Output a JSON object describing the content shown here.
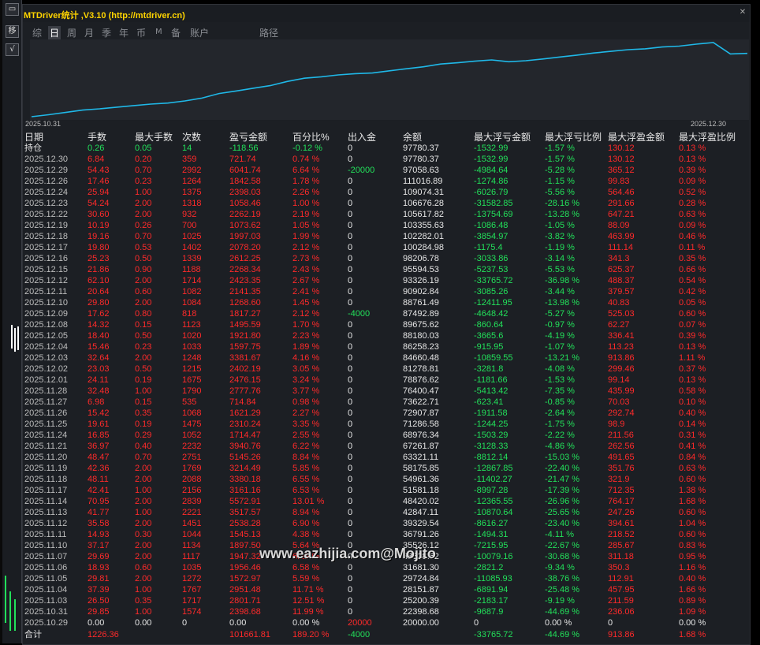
{
  "title": "MTDriver统计 ,V3.10 (http://mtdriver.cn)",
  "left_buttons": [
    "移",
    "√"
  ],
  "tabs": [
    {
      "label": "综",
      "active": false
    },
    {
      "label": "日",
      "active": true
    },
    {
      "label": "周",
      "active": false
    },
    {
      "label": "月",
      "active": false
    },
    {
      "label": "季",
      "active": false
    },
    {
      "label": "年",
      "active": false
    },
    {
      "label": "币",
      "active": false
    },
    {
      "label": "M",
      "active": false
    },
    {
      "label": "备",
      "active": false
    },
    {
      "label": "账户",
      "active": false
    },
    {
      "label": "路径",
      "active": false
    }
  ],
  "chart": {
    "start_label": "2025.10.31",
    "end_label": "2025.12.30",
    "line_color": "#1fb8e8",
    "balance_series": [
      20000,
      22398.68,
      25200.39,
      28151.87,
      29724.84,
      31681.3,
      33628.62,
      35526.12,
      36791.26,
      39329.54,
      42847.11,
      48420.02,
      51581.18,
      54961.36,
      58175.85,
      63321.11,
      67261.87,
      68976.34,
      71286.58,
      72907.87,
      73622.71,
      76400.47,
      78876.62,
      81278.81,
      84660.48,
      86258.23,
      88180.03,
      89675.62,
      87492.89,
      88761.49,
      90902.84,
      93326.19,
      95594.53,
      98206.78,
      100284.98,
      102282.01,
      103355.63,
      105617.82,
      106676.28,
      109074.31,
      111016.89,
      97058.63,
      97780.37
    ]
  },
  "colors": {
    "red": "#ff2a2a",
    "green": "#22e05a",
    "white": "#e6e6e6",
    "gray": "#bdbdbd"
  },
  "columns": [
    "日期",
    "手数",
    "最大手数",
    "次数",
    "盈亏金额",
    "百分比%",
    "出入金",
    "余额",
    "最大浮亏金额",
    "最大浮亏比例",
    "最大浮盈金额",
    "最大浮盈比例"
  ],
  "position_row": {
    "label": "持仓",
    "cells": [
      "0.26",
      "0.05",
      "14",
      "-118.56",
      "-0.12 %",
      "0",
      "97780.37",
      "-1532.99",
      "-1.57 %",
      "130.12",
      "0.13 %"
    ]
  },
  "rows": [
    [
      "2025.12.30",
      "6.84",
      "0.20",
      "359",
      "721.74",
      "0.74 %",
      "0",
      "97780.37",
      "-1532.99",
      "-1.57 %",
      "130.12",
      "0.13 %"
    ],
    [
      "2025.12.29",
      "54.43",
      "0.70",
      "2992",
      "6041.74",
      "6.64 %",
      "-20000",
      "97058.63",
      "-4984.64",
      "-5.28 %",
      "365.12",
      "0.39 %"
    ],
    [
      "2025.12.26",
      "17.46",
      "0.23",
      "1264",
      "1842.58",
      "1.78 %",
      "0",
      "111016.89",
      "-1274.86",
      "-1.15 %",
      "99.83",
      "0.09 %"
    ],
    [
      "2025.12.24",
      "25.94",
      "1.00",
      "1375",
      "2398.03",
      "2.26 %",
      "0",
      "109074.31",
      "-6026.79",
      "-5.56 %",
      "564.46",
      "0.52 %"
    ],
    [
      "2025.12.23",
      "54.24",
      "2.00",
      "1318",
      "1058.46",
      "1.00 %",
      "0",
      "106676.28",
      "-31582.85",
      "-28.16 %",
      "291.66",
      "0.28 %"
    ],
    [
      "2025.12.22",
      "30.60",
      "2.00",
      "932",
      "2262.19",
      "2.19 %",
      "0",
      "105617.82",
      "-13754.69",
      "-13.28 %",
      "647.21",
      "0.63 %"
    ],
    [
      "2025.12.19",
      "10.19",
      "0.26",
      "700",
      "1073.62",
      "1.05 %",
      "0",
      "103355.63",
      "-1086.48",
      "-1.05 %",
      "88.09",
      "0.09 %"
    ],
    [
      "2025.12.18",
      "19.16",
      "0.70",
      "1025",
      "1997.03",
      "1.99 %",
      "0",
      "102282.01",
      "-3854.97",
      "-3.82 %",
      "463.99",
      "0.46 %"
    ],
    [
      "2025.12.17",
      "19.80",
      "0.53",
      "1402",
      "2078.20",
      "2.12 %",
      "0",
      "100284.98",
      "-1175.4",
      "-1.19 %",
      "111.14",
      "0.11 %"
    ],
    [
      "2025.12.16",
      "25.23",
      "0.50",
      "1339",
      "2612.25",
      "2.73 %",
      "0",
      "98206.78",
      "-3033.86",
      "-3.14 %",
      "341.3",
      "0.35 %"
    ],
    [
      "2025.12.15",
      "21.86",
      "0.90",
      "1188",
      "2268.34",
      "2.43 %",
      "0",
      "95594.53",
      "-5237.53",
      "-5.53 %",
      "625.37",
      "0.66 %"
    ],
    [
      "2025.12.12",
      "62.10",
      "2.00",
      "1714",
      "2423.35",
      "2.67 %",
      "0",
      "93326.19",
      "-33765.72",
      "-36.98 %",
      "488.37",
      "0.54 %"
    ],
    [
      "2025.12.11",
      "20.64",
      "0.60",
      "1082",
      "2141.35",
      "2.41 %",
      "0",
      "90902.84",
      "-3085.26",
      "-3.44 %",
      "379.57",
      "0.42 %"
    ],
    [
      "2025.12.10",
      "29.80",
      "2.00",
      "1084",
      "1268.60",
      "1.45 %",
      "0",
      "88761.49",
      "-12411.95",
      "-13.98 %",
      "40.83",
      "0.05 %"
    ],
    [
      "2025.12.09",
      "17.62",
      "0.80",
      "818",
      "1817.27",
      "2.12 %",
      "-4000",
      "87492.89",
      "-4648.42",
      "-5.27 %",
      "525.03",
      "0.60 %"
    ],
    [
      "2025.12.08",
      "14.32",
      "0.15",
      "1123",
      "1495.59",
      "1.70 %",
      "0",
      "89675.62",
      "-860.64",
      "-0.97 %",
      "62.27",
      "0.07 %"
    ],
    [
      "2025.12.05",
      "18.40",
      "0.50",
      "1020",
      "1921.80",
      "2.23 %",
      "0",
      "88180.03",
      "-3665.6",
      "-4.19 %",
      "336.41",
      "0.39 %"
    ],
    [
      "2025.12.04",
      "15.46",
      "0.23",
      "1033",
      "1597.75",
      "1.89 %",
      "0",
      "86258.23",
      "-915.95",
      "-1.07 %",
      "113.23",
      "0.13 %"
    ],
    [
      "2025.12.03",
      "32.64",
      "2.00",
      "1248",
      "3381.67",
      "4.16 %",
      "0",
      "84660.48",
      "-10859.55",
      "-13.21 %",
      "913.86",
      "1.11 %"
    ],
    [
      "2025.12.02",
      "23.03",
      "0.50",
      "1215",
      "2402.19",
      "3.05 %",
      "0",
      "81278.81",
      "-3281.8",
      "-4.08 %",
      "299.46",
      "0.37 %"
    ],
    [
      "2025.12.01",
      "24.11",
      "0.19",
      "1675",
      "2476.15",
      "3.24 %",
      "0",
      "78876.62",
      "-1181.66",
      "-1.53 %",
      "99.14",
      "0.13 %"
    ],
    [
      "2025.11.28",
      "32.48",
      "1.00",
      "1790",
      "2777.76",
      "3.77 %",
      "0",
      "76400.47",
      "-5413.42",
      "-7.35 %",
      "435.99",
      "0.58 %"
    ],
    [
      "2025.11.27",
      "6.98",
      "0.15",
      "535",
      "714.84",
      "0.98 %",
      "0",
      "73622.71",
      "-623.41",
      "-0.85 %",
      "70.03",
      "0.10 %"
    ],
    [
      "2025.11.26",
      "15.42",
      "0.35",
      "1068",
      "1621.29",
      "2.27 %",
      "0",
      "72907.87",
      "-1911.58",
      "-2.64 %",
      "292.74",
      "0.40 %"
    ],
    [
      "2025.11.25",
      "19.61",
      "0.19",
      "1475",
      "2310.24",
      "3.35 %",
      "0",
      "71286.58",
      "-1244.25",
      "-1.75 %",
      "98.9",
      "0.14 %"
    ],
    [
      "2025.11.24",
      "16.85",
      "0.29",
      "1052",
      "1714.47",
      "2.55 %",
      "0",
      "68976.34",
      "-1503.29",
      "-2.22 %",
      "211.56",
      "0.31 %"
    ],
    [
      "2025.11.21",
      "36.97",
      "0.40",
      "2232",
      "3940.76",
      "6.22 %",
      "0",
      "67261.87",
      "-3128.33",
      "-4.86 %",
      "262.56",
      "0.41 %"
    ],
    [
      "2025.11.20",
      "48.47",
      "0.70",
      "2751",
      "5145.26",
      "8.84 %",
      "0",
      "63321.11",
      "-8812.14",
      "-15.03 %",
      "491.65",
      "0.84 %"
    ],
    [
      "2025.11.19",
      "42.36",
      "2.00",
      "1769",
      "3214.49",
      "5.85 %",
      "0",
      "58175.85",
      "-12867.85",
      "-22.40 %",
      "351.76",
      "0.63 %"
    ],
    [
      "2025.11.18",
      "48.11",
      "2.00",
      "2088",
      "3380.18",
      "6.55 %",
      "0",
      "54961.36",
      "-11402.27",
      "-21.47 %",
      "321.9",
      "0.60 %"
    ],
    [
      "2025.11.17",
      "42.41",
      "1.00",
      "2156",
      "3161.16",
      "6.53 %",
      "0",
      "51581.18",
      "-8997.28",
      "-17.39 %",
      "712.35",
      "1.38 %"
    ],
    [
      "2025.11.14",
      "70.95",
      "2.00",
      "2839",
      "5572.91",
      "13.01 %",
      "0",
      "48420.02",
      "-12365.55",
      "-26.96 %",
      "764.17",
      "1.68 %"
    ],
    [
      "2025.11.13",
      "41.77",
      "1.00",
      "2221",
      "3517.57",
      "8.94 %",
      "0",
      "42847.11",
      "-10870.64",
      "-25.65 %",
      "247.26",
      "0.60 %"
    ],
    [
      "2025.11.12",
      "35.58",
      "2.00",
      "1451",
      "2538.28",
      "6.90 %",
      "0",
      "39329.54",
      "-8616.27",
      "-23.40 %",
      "394.61",
      "1.04 %"
    ],
    [
      "2025.11.11",
      "14.93",
      "0.30",
      "1044",
      "1545.13",
      "4.38 %",
      "0",
      "36791.26",
      "-1494.31",
      "-4.11 %",
      "218.52",
      "0.60 %"
    ],
    [
      "2025.11.10",
      "37.17",
      "2.00",
      "1134",
      "1897.50",
      "5.64 %",
      "0",
      "35526.12",
      "-7215.95",
      "-22.67 %",
      "285.67",
      "0.83 %"
    ],
    [
      "2025.11.07",
      "29.69",
      "2.00",
      "1117",
      "1947.32",
      "6.23 %",
      "0",
      "33628.62",
      "-10079.16",
      "-30.68 %",
      "311.18",
      "0.95 %"
    ],
    [
      "2025.11.06",
      "18.93",
      "0.60",
      "1035",
      "1956.46",
      "6.58 %",
      "0",
      "31681.30",
      "-2821.2",
      "-9.34 %",
      "350.3",
      "1.16 %"
    ],
    [
      "2025.11.05",
      "29.81",
      "2.00",
      "1272",
      "1572.97",
      "5.59 %",
      "0",
      "29724.84",
      "-11085.93",
      "-38.76 %",
      "112.91",
      "0.40 %"
    ],
    [
      "2025.11.04",
      "37.39",
      "1.00",
      "1767",
      "2951.48",
      "11.71 %",
      "0",
      "28151.87",
      "-6891.94",
      "-25.48 %",
      "457.95",
      "1.66 %"
    ],
    [
      "2025.11.03",
      "26.50",
      "0.35",
      "1717",
      "2801.71",
      "12.51 %",
      "0",
      "25200.39",
      "-2183.17",
      "-9.19 %",
      "211.59",
      "0.89 %"
    ],
    [
      "2025.10.31",
      "29.85",
      "1.00",
      "1574",
      "2398.68",
      "11.99 %",
      "0",
      "22398.68",
      "-9687.9",
      "-44.69 %",
      "236.06",
      "1.09 %"
    ],
    [
      "2025.10.29",
      "0.00",
      "0.00",
      "0",
      "0.00",
      "0.00 %",
      "20000",
      "20000.00",
      "0",
      "0.00 %",
      "0",
      "0.00 %"
    ]
  ],
  "total_row": {
    "label": "合计",
    "cells": [
      "1226.36",
      "",
      "",
      "101661.81",
      "189.20 %",
      "-4000",
      "",
      "-33765.72",
      "-44.69 %",
      "913.86",
      "1.68 %"
    ]
  },
  "watermark": "www.eazhijia.com@Mojito"
}
